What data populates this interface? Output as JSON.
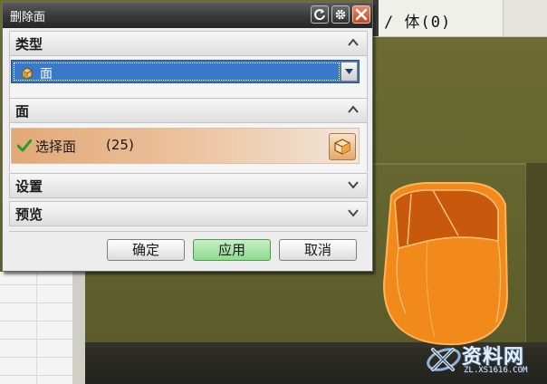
{
  "dialog": {
    "title": "删除面",
    "type_section": {
      "label": "类型",
      "selected": "面"
    },
    "face_section": {
      "label": "面",
      "select_label": "选择面",
      "count": "(25)"
    },
    "settings_section": {
      "label": "设置"
    },
    "preview_section": {
      "label": "预览"
    },
    "buttons": {
      "ok": "确定",
      "apply": "应用",
      "cancel": "取消"
    }
  },
  "toolbar": {
    "filter_text": "/ 体(0)"
  },
  "watermark": {
    "title": "资料网",
    "url": "ZL.XS1616.COM"
  },
  "colors": {
    "selection_blue": "#3a78c9",
    "highlight_orange": "#f08a1c",
    "apply_green": "#8fd98f",
    "titlebar": "#2f2f2f"
  }
}
